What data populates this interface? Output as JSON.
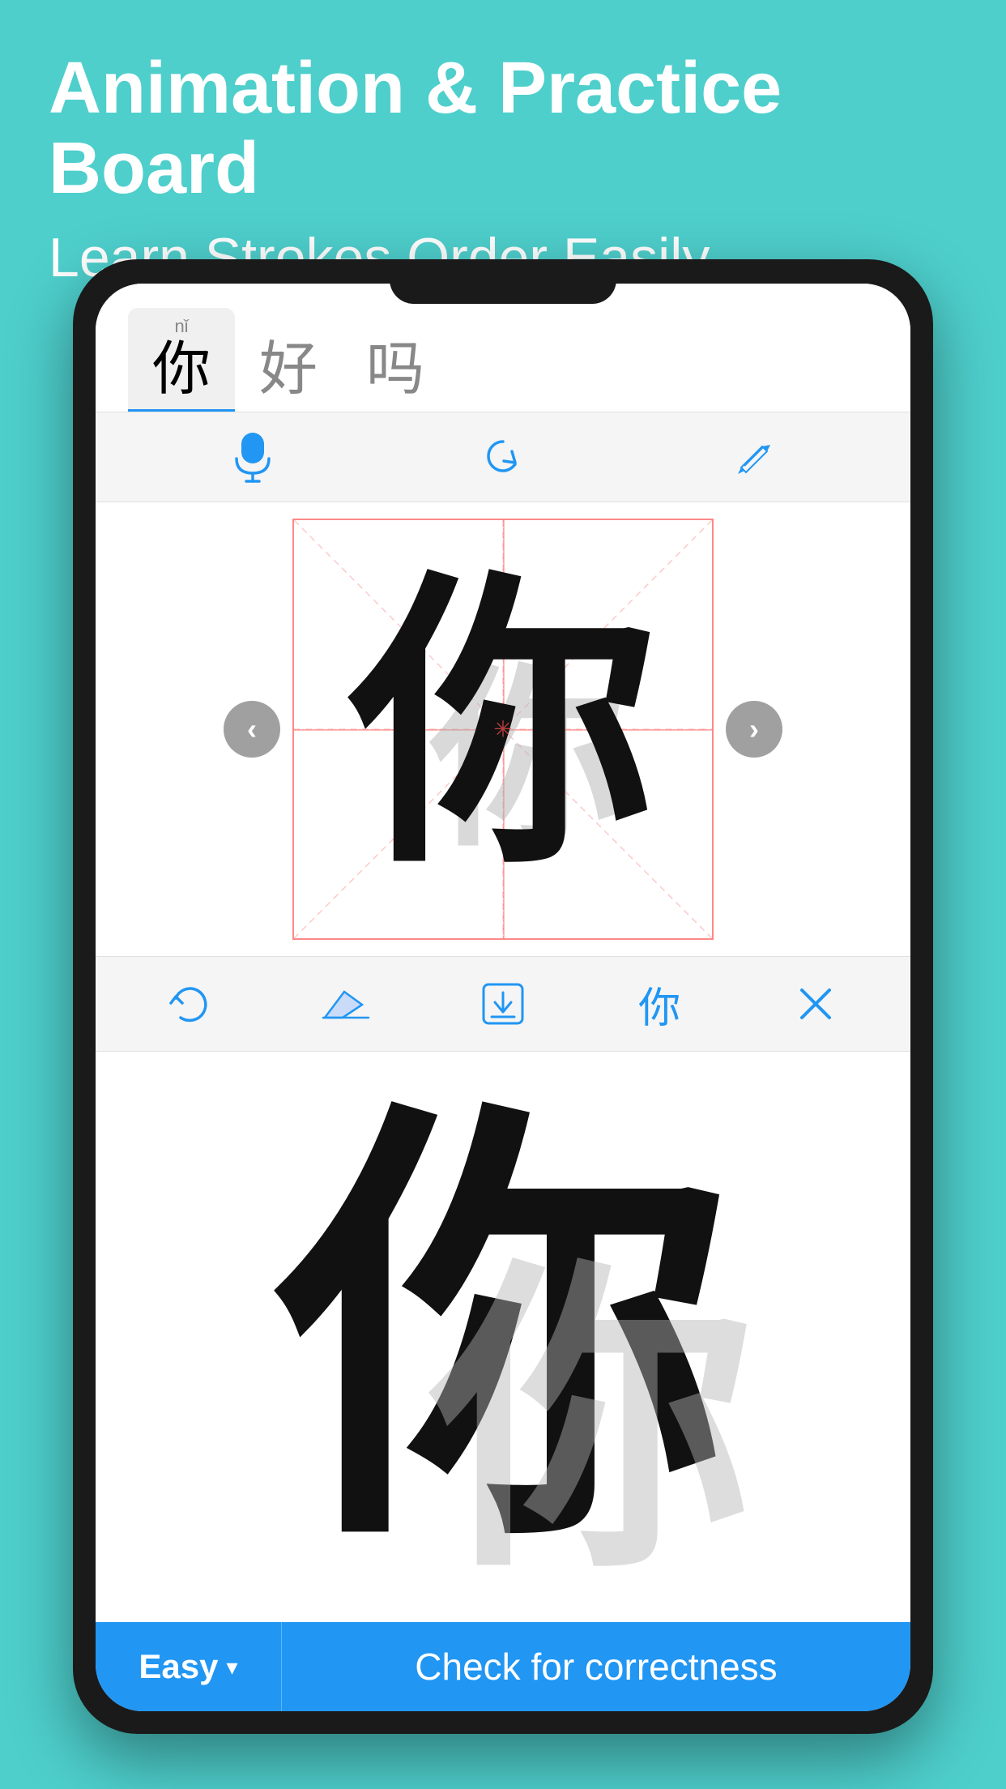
{
  "page": {
    "background_color": "#4ECFCC",
    "title": "Animation & Practice Board",
    "subtitle": "Learn Strokes Order Easily"
  },
  "tabs": [
    {
      "id": "ni",
      "pinyin": "nǐ",
      "char": "你",
      "active": true
    },
    {
      "id": "hao",
      "pinyin": "",
      "char": "好",
      "active": false
    },
    {
      "id": "ma",
      "pinyin": "",
      "char": "吗",
      "active": false
    }
  ],
  "toolbar": {
    "mic_label": "microphone",
    "refresh_label": "refresh",
    "pencil_label": "pencil"
  },
  "drawing": {
    "char": "你",
    "ghost_char": "你",
    "nav_prev": "‹",
    "nav_next": "›"
  },
  "bottom_toolbar": {
    "undo_label": "undo",
    "erase_label": "erase",
    "save_label": "save",
    "char_label": "你",
    "close_label": "close"
  },
  "display": {
    "large_char": "你"
  },
  "footer": {
    "easy_label": "Easy",
    "check_label": "Check for correctness",
    "easy_color": "#2196F3"
  }
}
